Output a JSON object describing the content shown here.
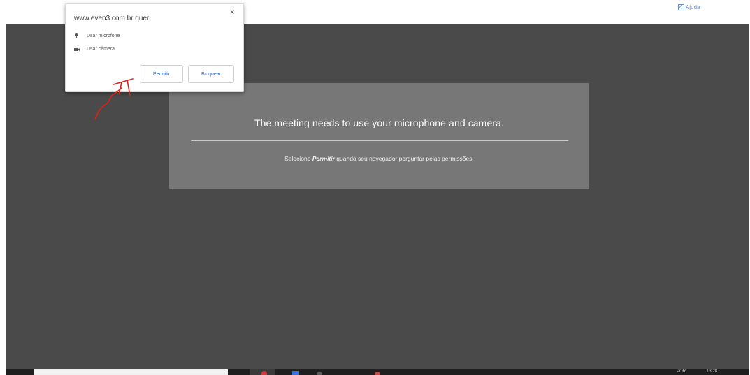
{
  "header": {
    "help_label": "Ajuda"
  },
  "notice": {
    "title": "The meeting needs to use your microphone and camera.",
    "subtitle_before": "Selecione ",
    "subtitle_bold": "Permitir",
    "subtitle_after": " quando seu navegador perguntar pelas permissões."
  },
  "permission_popup": {
    "origin": "www.even3.com.br quer",
    "close_symbol": "×",
    "mic_label": "Usar microfone",
    "camera_label": "Usar câmera",
    "allow_label": "Permitir",
    "block_label": "Bloquear"
  },
  "annotation": {
    "color": "#e0201c"
  },
  "colors": {
    "stage": "#4a4a4a",
    "notice_box": "#777777",
    "link_blue": "#2a62c9"
  },
  "taskbar": {
    "tray_left": "POR",
    "tray_right": "13:28"
  }
}
